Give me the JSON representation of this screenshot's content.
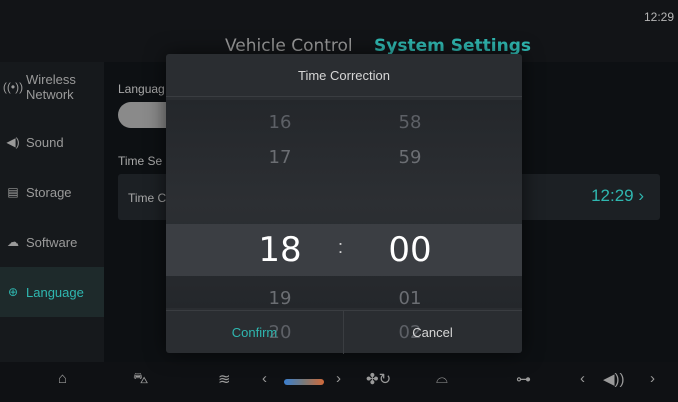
{
  "status_bar": {
    "clock": "12:29"
  },
  "tabs": [
    {
      "label": "Vehicle Control",
      "active": false
    },
    {
      "label": "System Settings",
      "active": true
    }
  ],
  "sidebar": {
    "items": [
      {
        "label": "Wireless Network",
        "icon": "wifi-icon",
        "active": false
      },
      {
        "label": "Sound",
        "icon": "speaker-icon",
        "active": false
      },
      {
        "label": "Storage",
        "icon": "storage-icon",
        "active": false
      },
      {
        "label": "Software",
        "icon": "cloud-download-icon",
        "active": false
      },
      {
        "label": "Language",
        "icon": "globe-icon",
        "active": true
      }
    ]
  },
  "main": {
    "language_label": "Languag",
    "time_section_label": "Time Se",
    "time_row_label": "Time C",
    "time_row_value": "12:29 ›"
  },
  "dialog": {
    "title": "Time Correction",
    "hours": {
      "above2": "16",
      "above1": "17",
      "selected": "18",
      "below1": "19",
      "below2": "20"
    },
    "separator": ":",
    "minutes": {
      "above2": "58",
      "above1": "59",
      "selected": "00",
      "below1": "01",
      "below2": "02"
    },
    "confirm_label": "Confirm",
    "cancel_label": "Cancel"
  },
  "bottom_bar": {
    "icons": [
      "home-icon",
      "car-icon",
      "rear-defrost-icon",
      "fan-icon",
      "front-defrost-icon",
      "car-profile-icon",
      "volume-icon"
    ]
  },
  "colors": {
    "accent": "#2fb7b0",
    "background": "#0a0d10",
    "dialog": "#2a2d31"
  }
}
